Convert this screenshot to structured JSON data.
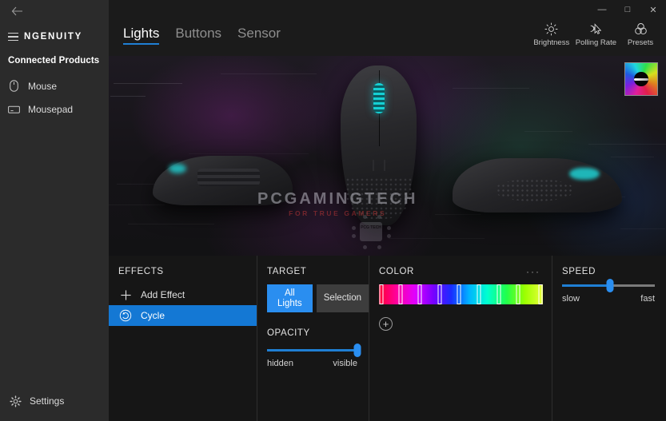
{
  "window": {
    "back_label": "←",
    "controls": [
      {
        "name": "minimize",
        "glyph": "—"
      },
      {
        "name": "maximize",
        "glyph": "□"
      },
      {
        "name": "close",
        "glyph": "✕"
      }
    ]
  },
  "sidebar": {
    "brand": "NGENUITY",
    "heading": "Connected Products",
    "items": [
      {
        "label": "Mouse",
        "icon": "mouse-icon"
      },
      {
        "label": "Mousepad",
        "icon": "mousepad-icon"
      }
    ],
    "settings": {
      "label": "Settings",
      "icon": "gear-icon"
    }
  },
  "tabs": [
    {
      "label": "Lights",
      "active": true
    },
    {
      "label": "Buttons",
      "active": false
    },
    {
      "label": "Sensor",
      "active": false
    }
  ],
  "tools": [
    {
      "label": "Brightness",
      "icon": "brightness-icon"
    },
    {
      "label": "Polling Rate",
      "icon": "polling-rate-icon"
    },
    {
      "label": "Presets",
      "icon": "presets-icon"
    }
  ],
  "hero": {
    "watermark_main": "PCGAMINGTECH",
    "watermark_sub": "FOR TRUE GAMERS",
    "chip_label": "PCG TECH",
    "preset_thumbnail": "rgb-ring-preset"
  },
  "panels": {
    "effects": {
      "title": "EFFECTS",
      "add_label": "Add Effect",
      "items": [
        {
          "label": "Cycle",
          "icon": "cycle-icon",
          "selected": true
        }
      ]
    },
    "target": {
      "title": "TARGET",
      "options": [
        {
          "label": "All Lights",
          "active": true
        },
        {
          "label": "Selection",
          "active": false
        }
      ],
      "opacity": {
        "title": "OPACITY",
        "min_label": "hidden",
        "max_label": "visible",
        "value": 100
      }
    },
    "color": {
      "title": "COLOR",
      "menu": "···",
      "add_label": "+",
      "gradient_css": "linear-gradient(90deg, #ff0033 0%, #ff00a0 11%, #e000ff 22%, #7a00ff 33%, #1a2cff 44%, #00b4ff 55%, #00ffd0 66%, #22ff4a 78%, #9cff00 89%, #e8ff3a 100%)",
      "stops": [
        {
          "position": 1.5,
          "color": "#ff0033"
        },
        {
          "position": 13,
          "color": "#ff00a0"
        },
        {
          "position": 25,
          "color": "#e000ff"
        },
        {
          "position": 37,
          "color": "#3a00ff"
        },
        {
          "position": 49,
          "color": "#00b4ff"
        },
        {
          "position": 61,
          "color": "#00ffd0"
        },
        {
          "position": 73,
          "color": "#22ff4a"
        },
        {
          "position": 85,
          "color": "#9cff00"
        },
        {
          "position": 98.5,
          "color": "#e8ff3a"
        }
      ]
    },
    "speed": {
      "title": "SPEED",
      "min_label": "slow",
      "max_label": "fast",
      "value": 52
    }
  },
  "colors": {
    "accent": "#1f7fd4",
    "accent_bright": "#2a8ef0",
    "sidebar_bg": "#2b2b2b",
    "panel_bg": "#161616",
    "teal_led": "#1fc7c9"
  }
}
